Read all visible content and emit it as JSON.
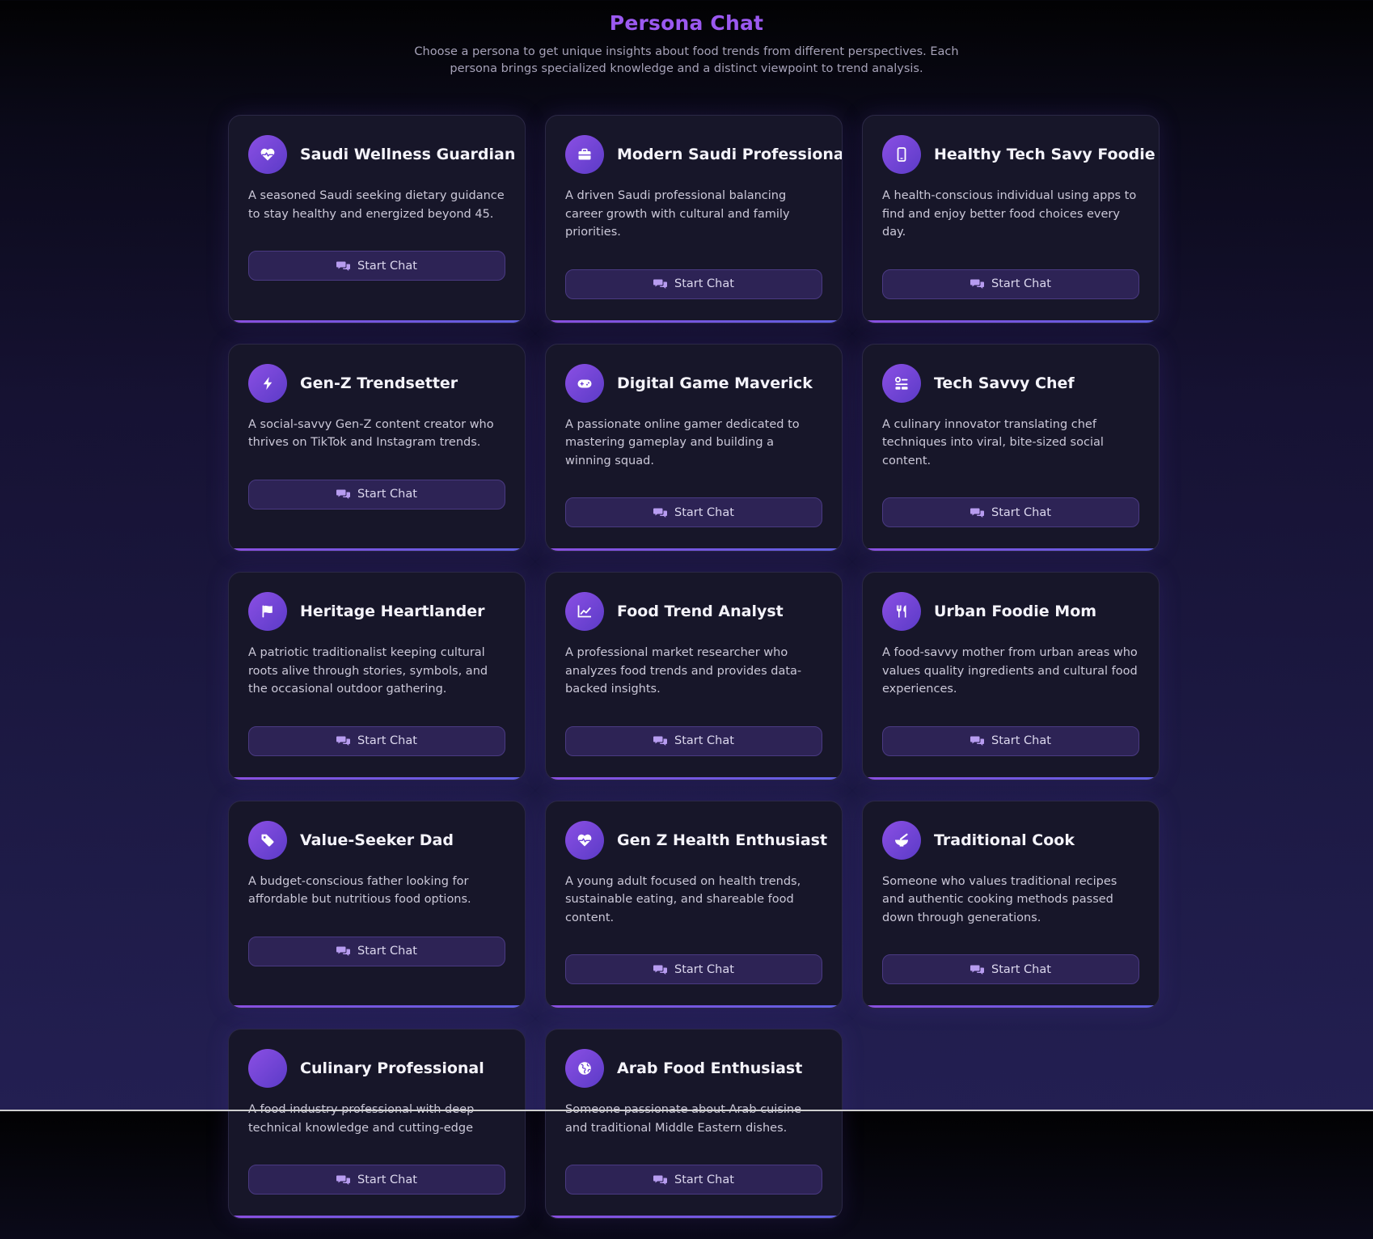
{
  "header": {
    "title": "Persona Chat",
    "subtitle": "Choose a persona to get unique insights about food trends from different perspectives. Each persona brings specialized knowledge and a distinct viewpoint to trend analysis."
  },
  "button_label": "Start Chat",
  "personas": [
    {
      "name": "Saudi Wellness Guardian",
      "icon": "heart-pulse-icon",
      "desc": "A seasoned Saudi seeking dietary guidance to stay healthy and energized beyond 45."
    },
    {
      "name": "Modern Saudi Professional",
      "icon": "briefcase-icon",
      "desc": "A driven Saudi professional balancing career growth with cultural and family priorities."
    },
    {
      "name": "Healthy Tech Savy Foodie",
      "icon": "smartphone-icon",
      "desc": "A health-conscious individual using apps to find and enjoy better food choices every day."
    },
    {
      "name": "Gen-Z Trendsetter",
      "icon": "bolt-icon",
      "desc": "A social-savvy Gen-Z content creator who thrives on TikTok and Instagram trends."
    },
    {
      "name": "Digital Game Maverick",
      "icon": "gamepad-icon",
      "desc": "A passionate online gamer dedicated to mastering gameplay and building a winning squad."
    },
    {
      "name": "Tech Savvy Chef",
      "icon": "kitchen-sliders-icon",
      "desc": "A culinary innovator translating chef techniques into viral, bite-sized social content."
    },
    {
      "name": "Heritage Heartlander",
      "icon": "flag-icon",
      "desc": "A patriotic traditionalist keeping cultural roots alive through stories, symbols, and the occasional outdoor gathering."
    },
    {
      "name": "Food Trend Analyst",
      "icon": "chart-line-icon",
      "desc": "A professional market researcher who analyzes food trends and provides data-backed insights."
    },
    {
      "name": "Urban Foodie Mom",
      "icon": "utensils-icon",
      "desc": "A food-savvy mother from urban areas who values quality ingredients and cultural food experiences."
    },
    {
      "name": "Value-Seeker Dad",
      "icon": "tag-icon",
      "desc": "A budget-conscious father looking for affordable but nutritious food options."
    },
    {
      "name": "Gen Z Health Enthusiast",
      "icon": "heart-pulse-icon",
      "desc": "A young adult focused on health trends, sustainable eating, and shareable food content."
    },
    {
      "name": "Traditional Cook",
      "icon": "mortar-bowl-icon",
      "desc": "Someone who values traditional recipes and authentic cooking methods passed down through generations."
    },
    {
      "name": "Culinary Professional",
      "icon": "",
      "desc": "A food industry professional with deep technical knowledge and cutting-edge"
    },
    {
      "name": "Arab Food Enthusiast",
      "icon": "globe-icon",
      "desc": "Someone passionate about Arab cuisine and traditional Middle Eastern dishes."
    }
  ]
}
